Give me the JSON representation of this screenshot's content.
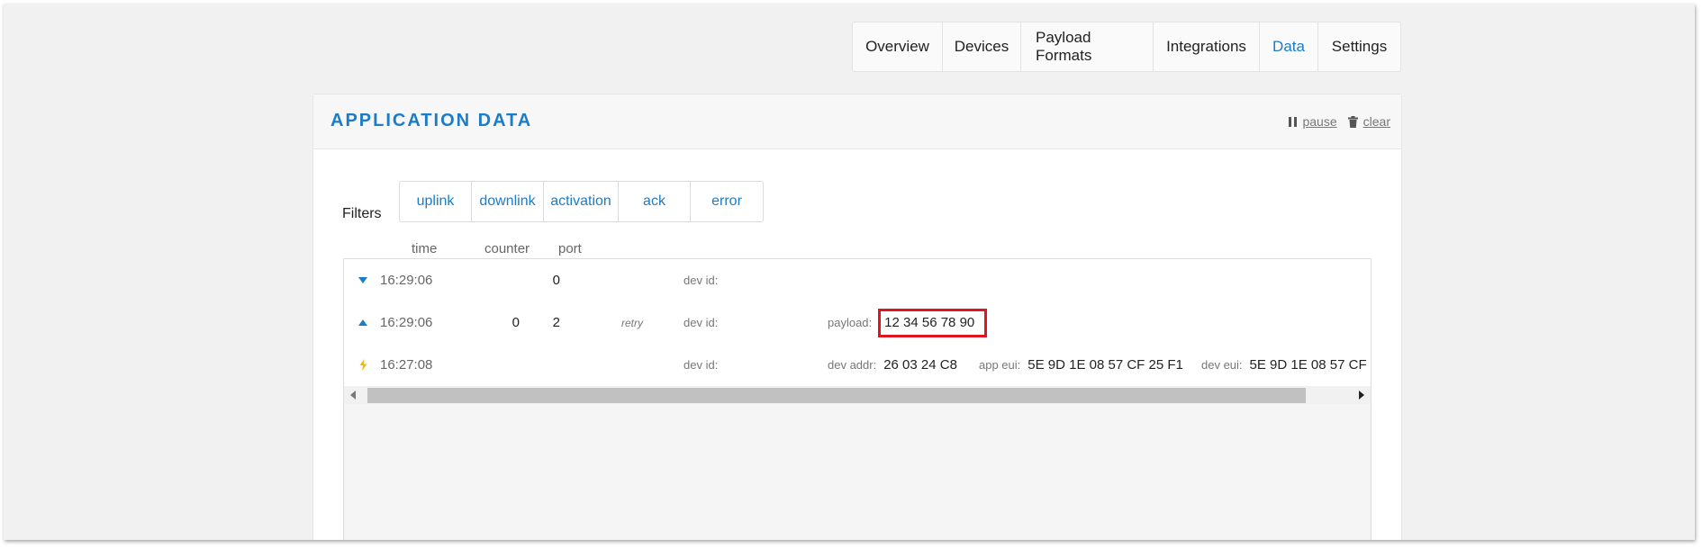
{
  "nav": {
    "tabs": [
      {
        "label": "Overview",
        "active": false
      },
      {
        "label": "Devices",
        "active": false
      },
      {
        "label": "Payload Formats",
        "active": false
      },
      {
        "label": "Integrations",
        "active": false
      },
      {
        "label": "Data",
        "active": true
      },
      {
        "label": "Settings",
        "active": false
      }
    ]
  },
  "panel": {
    "title": "APPLICATION DATA",
    "pause_label": "pause",
    "clear_label": "clear"
  },
  "filters": {
    "label": "Filters",
    "items": [
      "uplink",
      "downlink",
      "activation",
      "ack",
      "error"
    ]
  },
  "columns": {
    "time": "time",
    "counter": "counter",
    "port": "port"
  },
  "rows": [
    {
      "type": "downlink",
      "icon": "triangle-down-icon",
      "time": "16:29:06",
      "counter": "",
      "port": "0",
      "retry": "",
      "dev_id_label": "dev id:"
    },
    {
      "type": "uplink",
      "icon": "triangle-up-icon",
      "time": "16:29:06",
      "counter": "0",
      "port": "2",
      "retry": "retry",
      "dev_id_label": "dev id:",
      "payload_label": "payload:",
      "payload_value": "12 34 56 78 90"
    },
    {
      "type": "activation",
      "icon": "lightning-icon",
      "time": "16:27:08",
      "counter": "",
      "port": "",
      "retry": "",
      "dev_id_label": "dev id:",
      "dev_addr_label": "dev addr:",
      "dev_addr_value": "26 03 24 C8",
      "app_eui_label": "app eui:",
      "app_eui_value": "5E 9D 1E 08 57 CF 25 F1",
      "dev_eui_label": "dev eui:",
      "dev_eui_value": "5E 9D 1E 08 57 CF"
    }
  ],
  "colors": {
    "accent": "#1d7cc7",
    "highlight": "#e2141f",
    "lightning": "#f5b800"
  }
}
